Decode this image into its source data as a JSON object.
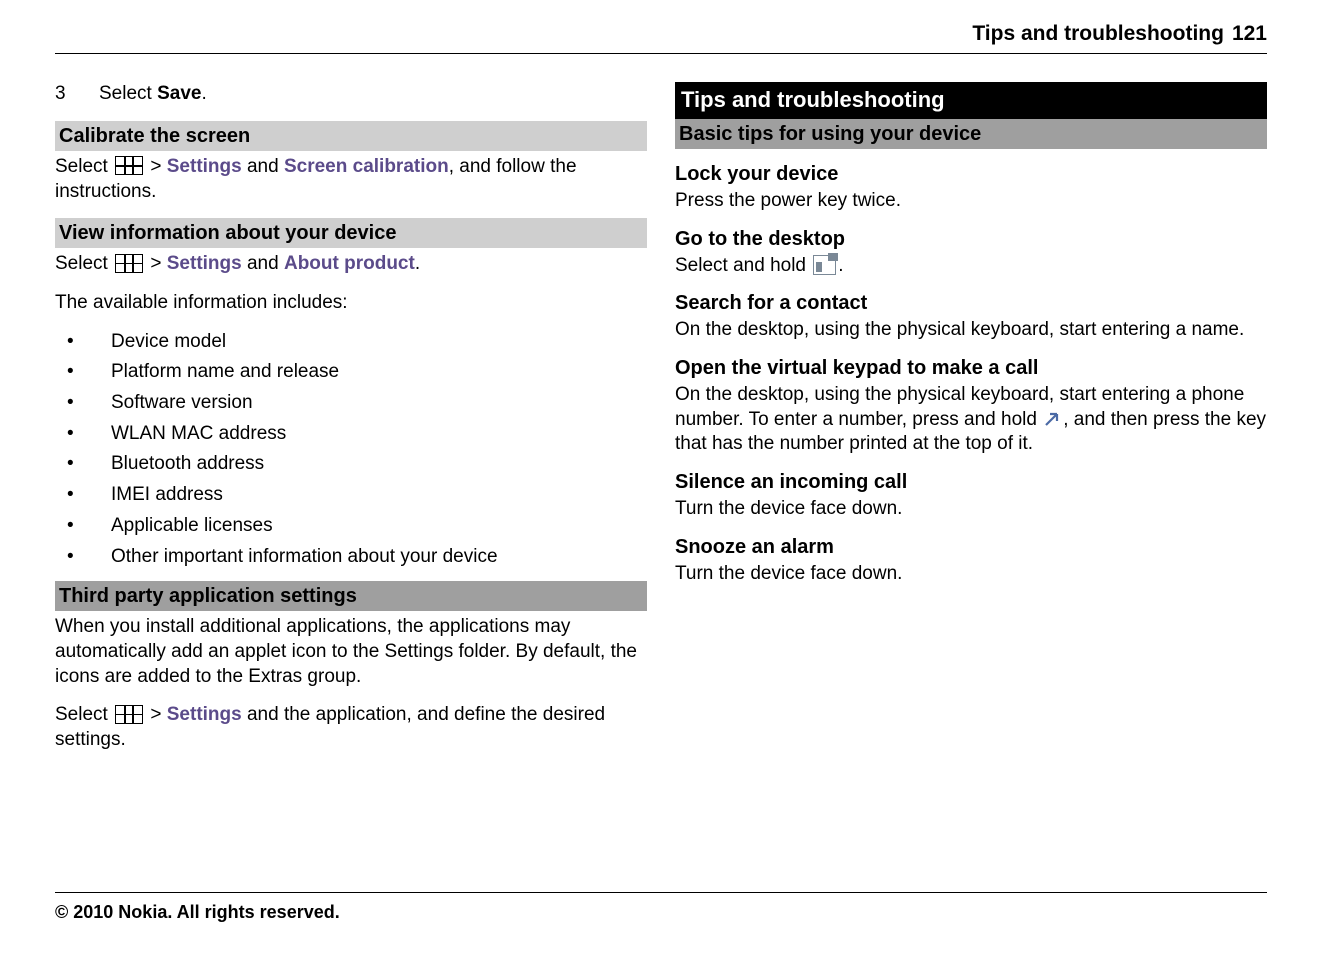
{
  "header": {
    "title": "Tips and troubleshooting",
    "page": "121"
  },
  "left": {
    "step": {
      "num": "3",
      "prefix": "Select ",
      "bold": "Save",
      "suffix": "."
    },
    "h1": "Calibrate the screen",
    "h1_text": {
      "p1": "Select ",
      "gt": " > ",
      "settings": "Settings",
      "and": " and ",
      "screen_cal": "Screen calibration",
      "suffix": ", and follow the instructions."
    },
    "h2": "View information about your device",
    "h2_text": {
      "p1": "Select ",
      "gt": " > ",
      "settings": "Settings",
      "and": " and ",
      "about": "About product",
      "suffix": "."
    },
    "h2_intro": "The available information includes:",
    "bullets": [
      "Device model",
      "Platform name and release",
      "Software version",
      "WLAN MAC address",
      "Bluetooth address",
      "IMEI address",
      "Applicable licenses",
      "Other important information about your device"
    ],
    "h3": "Third party application settings",
    "h3_p1": "When you install additional applications, the applications may automatically add an applet icon to the Settings folder. By default, the icons are added to the Extras group.",
    "h3_text": {
      "p1": "Select ",
      "gt": " > ",
      "settings": "Settings",
      "suffix": " and the application, and define the desired settings."
    }
  },
  "right": {
    "maintitle": "Tips and troubleshooting",
    "subtitle": "Basic tips for using your device",
    "sec1_h": "Lock your device",
    "sec1_p": "Press the power key twice.",
    "sec2_h": "Go to the desktop",
    "sec2_p_pre": "Select and hold ",
    "sec2_p_post": ".",
    "sec3_h": "Search for a contact",
    "sec3_p": "On the desktop, using the physical keyboard, start entering a name.",
    "sec4_h": "Open the virtual keypad to make a call",
    "sec4_p_pre": "On the desktop, using the physical keyboard, start entering a phone number. To enter a number, press and hold ",
    "sec4_p_post": ", and then press the key that has the number printed at the top of it.",
    "sec5_h": "Silence an incoming call",
    "sec5_p": "Turn the device face down.",
    "sec6_h": "Snooze an alarm",
    "sec6_p": "Turn the device face down."
  },
  "footer": "© 2010 Nokia. All rights reserved."
}
